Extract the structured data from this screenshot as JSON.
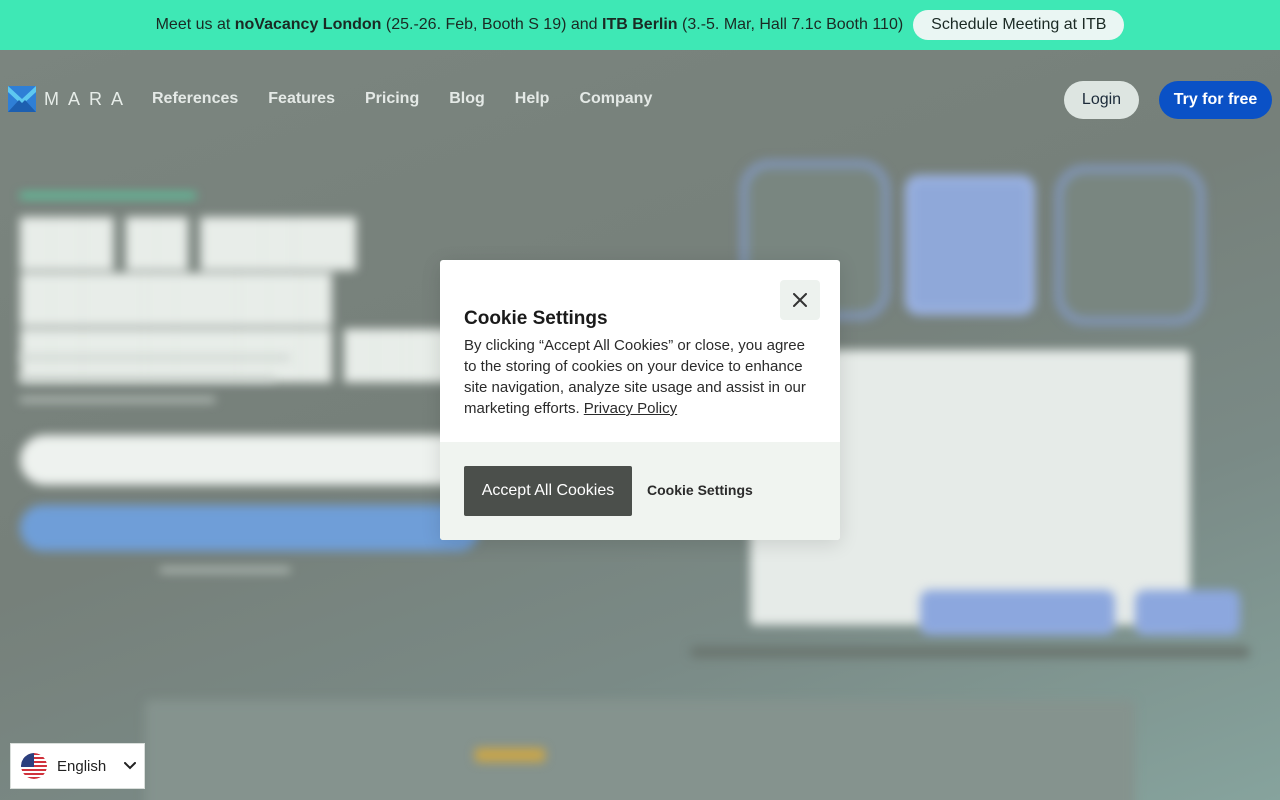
{
  "announcement": {
    "prefix": "Meet us at ",
    "event1": "noVacancy London",
    "event1_detail": " (25.-26. Feb, Booth S 19) and ",
    "event2": "ITB Berlin",
    "event2_detail": " (3.-5. Mar, Hall 7.1c Booth 110)",
    "button_label": "Schedule Meeting at ITB"
  },
  "nav": {
    "logo_text": "MARA",
    "links": [
      "References",
      "Features",
      "Pricing",
      "Blog",
      "Help",
      "Company"
    ],
    "login_label": "Login",
    "try_label": "Try for free"
  },
  "cookie_dialog": {
    "title": "Cookie Settings",
    "body": "By clicking “Accept All Cookies” or close, you agree to the storing of cookies on your device to enhance site navigation, analyze site usage and assist in our marketing efforts. ",
    "privacy_link": "Privacy Policy",
    "accept_label": "Accept All Cookies",
    "settings_label": "Cookie Settings"
  },
  "language": {
    "selected": "English"
  },
  "colors": {
    "announce_bg": "#3ee8b5",
    "primary_blue": "#0a51c6",
    "accept_bg": "#4b4f4b"
  }
}
